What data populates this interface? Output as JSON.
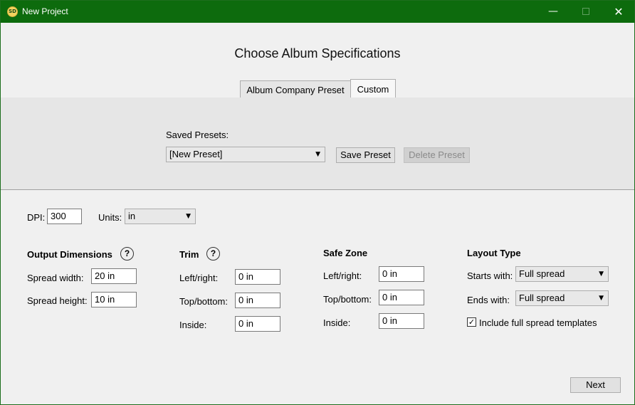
{
  "window": {
    "title": "New Project",
    "app_icon_text": "SD",
    "minimize_glyph": "—",
    "close_glyph": "✕"
  },
  "header": {
    "title": "Choose Album Specifications",
    "tabs": [
      {
        "label": "Album Company Preset"
      },
      {
        "label": "Custom"
      }
    ]
  },
  "presets": {
    "label": "Saved Presets:",
    "selected": "[New Preset]",
    "save_label": "Save Preset",
    "delete_label": "Delete Preset"
  },
  "general": {
    "dpi_label": "DPI:",
    "dpi_value": "300",
    "units_label": "Units:",
    "units_value": "in"
  },
  "output": {
    "title": "Output Dimensions",
    "help": "?",
    "spread_width_label": "Spread width:",
    "spread_width_value": "20 in",
    "spread_height_label": "Spread height:",
    "spread_height_value": "10 in"
  },
  "trim": {
    "title": "Trim",
    "help": "?",
    "left_right_label": "Left/right:",
    "left_right_value": "0 in",
    "top_bottom_label": "Top/bottom:",
    "top_bottom_value": "0 in",
    "inside_label": "Inside:",
    "inside_value": "0 in"
  },
  "safe_zone": {
    "title": "Safe Zone",
    "left_right_label": "Left/right:",
    "left_right_value": "0 in",
    "top_bottom_label": "Top/bottom:",
    "top_bottom_value": "0 in",
    "inside_label": "Inside:",
    "inside_value": "0 in"
  },
  "layout": {
    "title": "Layout Type",
    "starts_label": "Starts with:",
    "starts_value": "Full spread",
    "ends_label": "Ends with:",
    "ends_value": "Full spread",
    "include_label": "Include full spread templates",
    "include_checked": true,
    "check_glyph": "✓"
  },
  "footer": {
    "next_label": "Next"
  },
  "colors": {
    "titlebar": "#0d6b0d",
    "panel": "#e6e6e6",
    "background": "#f0f0f0"
  }
}
